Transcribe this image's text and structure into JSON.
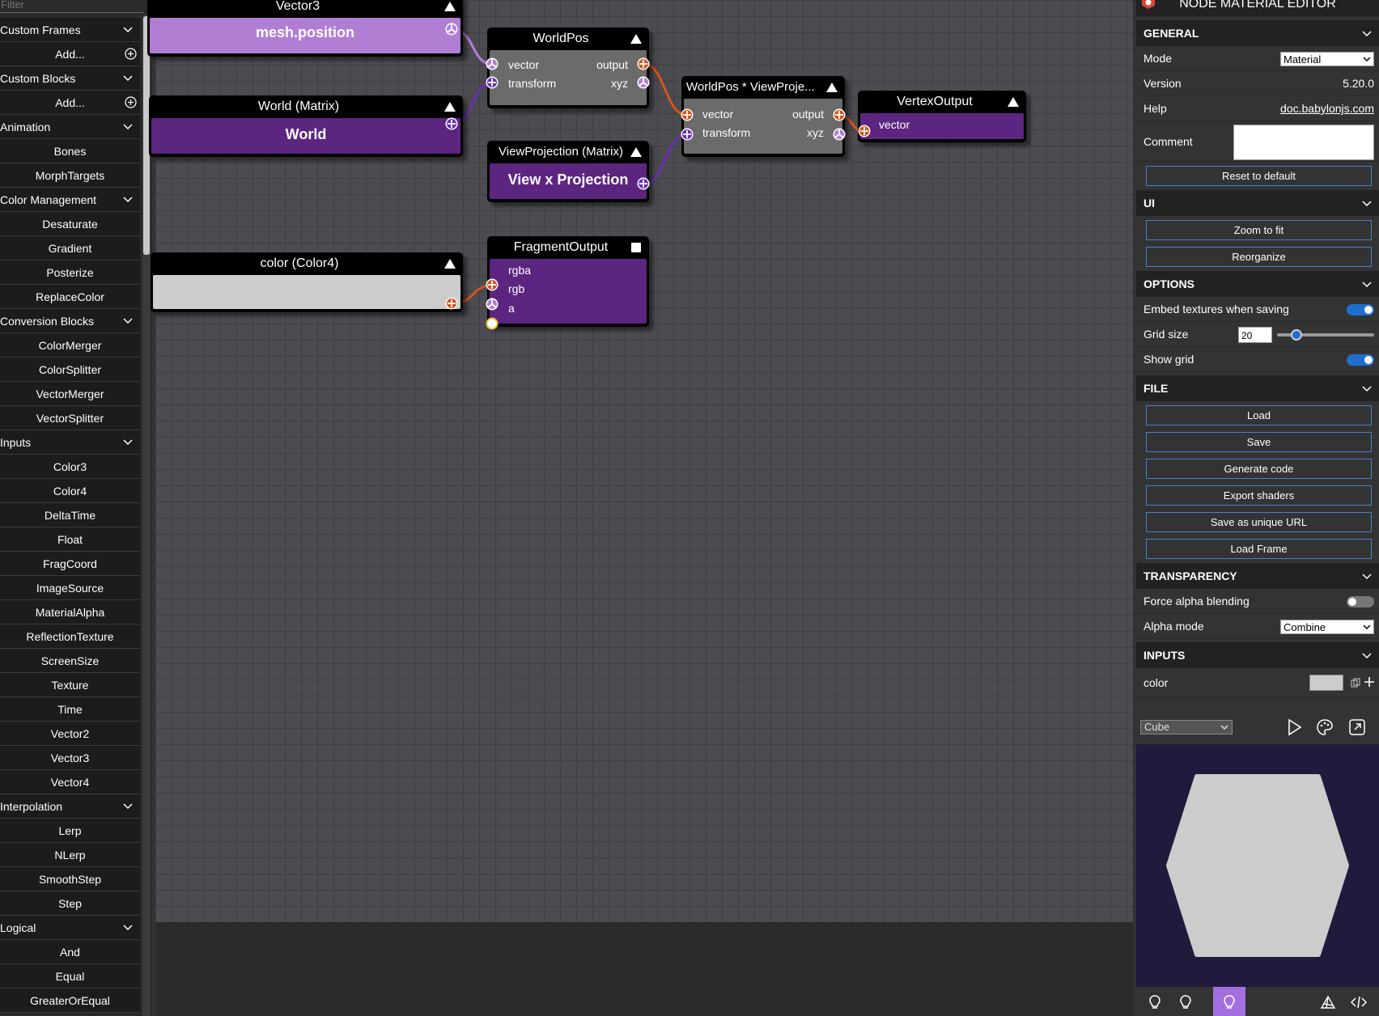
{
  "left_panel": {
    "filter_placeholder": "Filter",
    "categories": [
      {
        "label": "Custom Frames",
        "items": [
          "Add..."
        ]
      },
      {
        "label": "Custom Blocks",
        "items": [
          "Add..."
        ]
      },
      {
        "label": "Animation",
        "items": [
          "Bones",
          "MorphTargets"
        ]
      },
      {
        "label": "Color Management",
        "items": [
          "Desaturate",
          "Gradient",
          "Posterize",
          "ReplaceColor"
        ]
      },
      {
        "label": "Conversion Blocks",
        "items": [
          "ColorMerger",
          "ColorSplitter",
          "VectorMerger",
          "VectorSplitter"
        ]
      },
      {
        "label": "Inputs",
        "items": [
          "Color3",
          "Color4",
          "DeltaTime",
          "Float",
          "FragCoord",
          "ImageSource",
          "MaterialAlpha",
          "ReflectionTexture",
          "ScreenSize",
          "Texture",
          "Time",
          "Vector2",
          "Vector3",
          "Vector4"
        ]
      },
      {
        "label": "Interpolation",
        "items": [
          "Lerp",
          "NLerp",
          "SmoothStep",
          "Step"
        ]
      },
      {
        "label": "Logical",
        "items": [
          "And",
          "Equal",
          "GreaterOrEqual"
        ]
      }
    ]
  },
  "nodes": {
    "vector3": {
      "title": "Vector3",
      "value": "mesh.position"
    },
    "world": {
      "title": "World (Matrix)",
      "value": "World"
    },
    "worldpos": {
      "title": "WorldPos",
      "in1": "vector",
      "in2": "transform",
      "out1": "output",
      "out2": "xyz"
    },
    "viewproj": {
      "title": "ViewProjection (Matrix)",
      "value": "View x Projection"
    },
    "worldposvp": {
      "title": "WorldPos * ViewProje...",
      "in1": "vector",
      "in2": "transform",
      "out1": "output",
      "out2": "xyz"
    },
    "vertexout": {
      "title": "VertexOutput",
      "in1": "vector"
    },
    "color": {
      "title": "color (Color4)"
    },
    "fragout": {
      "title": "FragmentOutput",
      "in1": "rgba",
      "in2": "rgb",
      "in3": "a"
    }
  },
  "right_panel": {
    "title": "NODE MATERIAL EDITOR",
    "general": {
      "header": "GENERAL",
      "mode_label": "Mode",
      "mode_value": "Material",
      "version_label": "Version",
      "version_value": "5.20.0",
      "help_label": "Help",
      "help_link": "doc.babylonjs.com",
      "comment_label": "Comment",
      "reset_button": "Reset to default"
    },
    "ui": {
      "header": "UI",
      "zoom_button": "Zoom to fit",
      "reorganize_button": "Reorganize"
    },
    "options": {
      "header": "OPTIONS",
      "embed_label": "Embed textures when saving",
      "embed_on": true,
      "grid_size_label": "Grid size",
      "grid_size_value": "20",
      "grid_slider_fraction": 0.2,
      "show_grid_label": "Show grid",
      "show_grid_on": true
    },
    "file": {
      "header": "FILE",
      "buttons": [
        "Load",
        "Save",
        "Generate code",
        "Export shaders",
        "Save as unique URL",
        "Load Frame"
      ]
    },
    "transparency": {
      "header": "TRANSPARENCY",
      "force_alpha_label": "Force alpha blending",
      "force_alpha_on": false,
      "alpha_mode_label": "Alpha mode",
      "alpha_mode_value": "Combine"
    },
    "inputs": {
      "header": "INPUTS",
      "color_label": "color",
      "color_swatch": "#cccccc"
    },
    "preview": {
      "mesh_value": "Cube",
      "background": "#221a3d",
      "shape_color": "#cccccc"
    }
  },
  "colors": {
    "accent_blue": "#4a7fc8",
    "node_purple": "#5c2580",
    "node_light_purple": "#b07ed3",
    "node_gray": "#6b6b6b",
    "link_orange": "#d4541e",
    "link_purple": "#6a2fb0",
    "link_light_purple": "#b07ed3"
  }
}
